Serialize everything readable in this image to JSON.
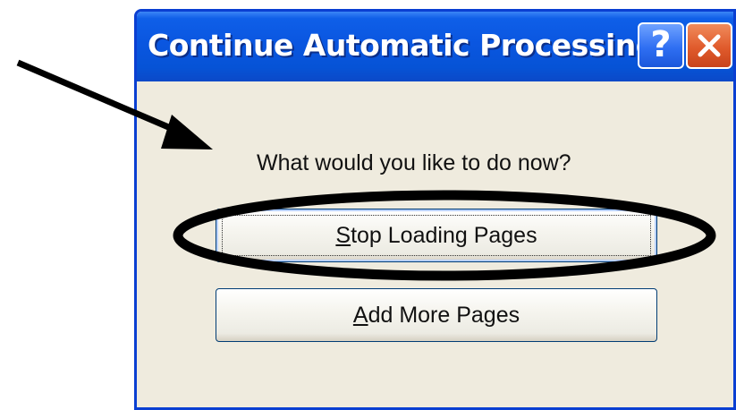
{
  "dialog": {
    "title": "Continue Automatic Processing",
    "help_glyph": "?",
    "prompt": "What would you like to do now?",
    "buttons": {
      "stop": {
        "accel": "S",
        "rest": "top Loading Pages"
      },
      "add": {
        "accel": "A",
        "rest": "dd More Pages"
      }
    }
  },
  "colors": {
    "titlebar": "#0a56e0",
    "dialog_bg": "#efebde",
    "close_button": "#e05b2c",
    "annotation": "#000000"
  },
  "icons": {
    "help": "help-icon",
    "close": "close-icon",
    "annotation_arrow": "arrow-icon",
    "annotation_ellipse": "highlight-ellipse"
  }
}
